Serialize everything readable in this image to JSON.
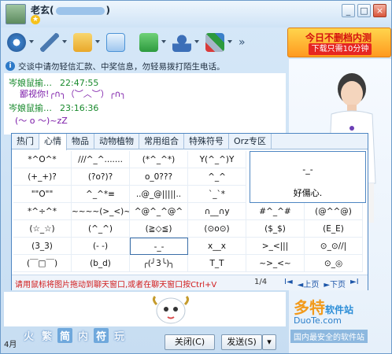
{
  "window": {
    "contact_name": "老玄(",
    "contact_name_suffix": ")",
    "win_buttons": [
      "_",
      "□",
      "×"
    ]
  },
  "toolbar": {
    "more": "»",
    "tools": [
      {
        "name": "video-call",
        "color": "#3b80c9"
      },
      {
        "name": "voice",
        "color": "#4a79b0"
      },
      {
        "name": "file-transfer",
        "color": "#e9a82a"
      },
      {
        "name": "mail",
        "color": "#4c93d6"
      },
      {
        "name": "app-add",
        "color": "#2d9a3e"
      },
      {
        "name": "contacts",
        "color": "#3c6fb8"
      },
      {
        "name": "games",
        "color": "#a6b6c8"
      }
    ]
  },
  "ad": {
    "line1": "今日不删档内测",
    "line2": "下载只需10分钟"
  },
  "notice": {
    "text": "交谈中请勿轻信汇款、中奖信息，勿轻易拨打陌生电话。"
  },
  "chat": {
    "messages": [
      {
        "sender": "岑娘鼠揄…",
        "time": "22:47:55",
        "text": "鄙视你!╭∩╮（︶︿︶）╭∩╮"
      },
      {
        "sender": "岑娘鼠揄…",
        "time": "23:16:36",
        "text": "(～ o ～)~zZ"
      }
    ]
  },
  "emoticon_panel": {
    "tabs": [
      "热门",
      "心情",
      "物品",
      "动物植物",
      "常用组合",
      "特殊符号",
      "Orz专区"
    ],
    "active_tab": "心情",
    "preview": {
      "emoticon": "-_-",
      "label": "好偒心."
    },
    "rows": [
      [
        "*^O^*",
        "///^_^.......",
        "(*^_^*)",
        "Y(^_^)Y"
      ],
      [
        "(+_+)?",
        "(?o?)?",
        "o_0???",
        "^_^"
      ],
      [
        "\"\"O\"\"",
        "^_^*≡",
        "..@_@|||||..",
        "`_`*"
      ],
      [
        "*^÷^*",
        "~~~~(>_<)~~~~",
        "^@^_^@^",
        "∩__∩y",
        "#^_^#",
        "(@^^@)"
      ],
      [
        "(☆_☆)",
        "(^_^)",
        "(≧◇≦)",
        "(⊙o⊙)",
        "($_$)",
        "(E_E)"
      ],
      [
        "(3_3)",
        "(- -)",
        "-_-",
        "x__x",
        ">_<|||",
        "⊙_⊙//|"
      ],
      [
        "(￣□￣)",
        "(b_d)",
        "╭(╯3╰)╮",
        "T_T",
        "~>_<~",
        "⊙_◎"
      ]
    ],
    "hint": "请用鼠标将图片拖动到聊天窗口,或者在聊天窗口按Ctrl+V",
    "page": "1/4",
    "pager": [
      "I◄",
      "◄上页",
      "►下页",
      "►I"
    ]
  },
  "bottom": {
    "font_chars": [
      "火",
      "繁",
      "简",
      "内",
      "符",
      "玩"
    ],
    "status": "4月",
    "close_label": "关闭(C)",
    "send_label": "发送(S)",
    "send_arrow": "▾"
  },
  "watermark": {
    "brand": "多特",
    "brand_sub": "软件站",
    "domain": "DuoTe.com",
    "slogan": "国内最安全的软件站"
  }
}
